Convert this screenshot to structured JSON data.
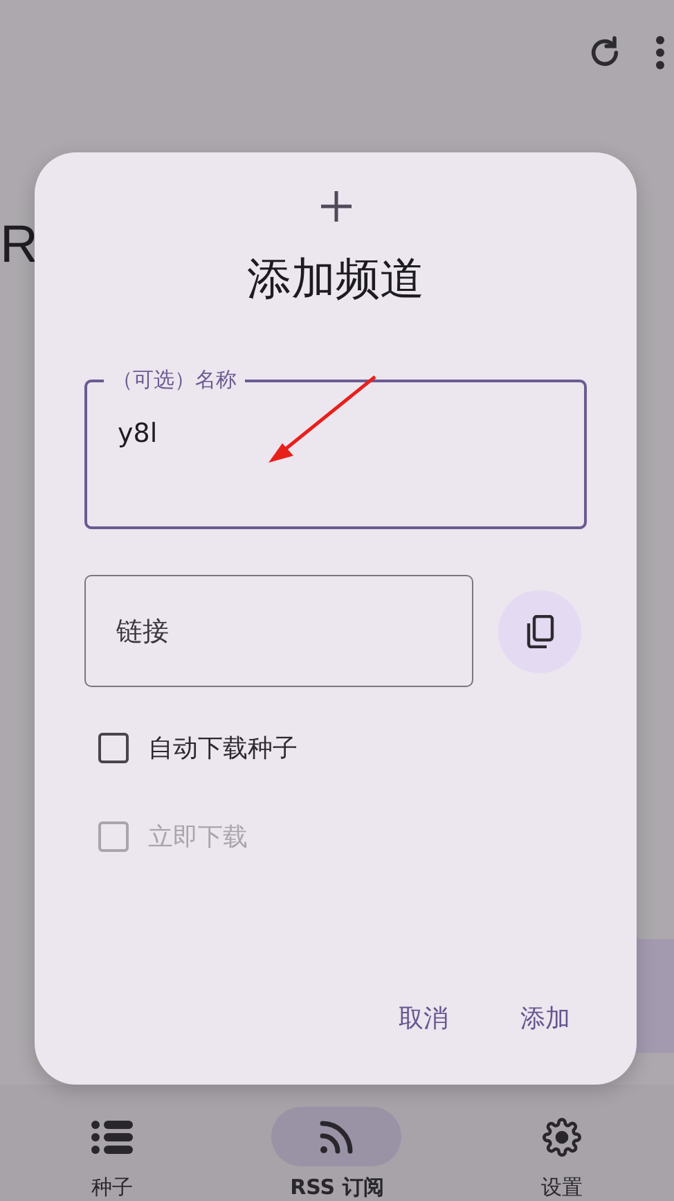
{
  "page": {
    "title": "R"
  },
  "dialog": {
    "title": "添加频道",
    "name_field": {
      "label": "（可选）名称",
      "value": "y8l",
      "focused": true
    },
    "link_field": {
      "placeholder": "链接"
    },
    "options": [
      {
        "label": "自动下载种子",
        "checked": false,
        "disabled": false
      },
      {
        "label": "立即下载",
        "checked": false,
        "disabled": true
      }
    ],
    "buttons": [
      {
        "label": "取消"
      },
      {
        "label": "添加"
      }
    ]
  },
  "bottom_nav": [
    {
      "label": "种子",
      "selected": false
    },
    {
      "label": "RSS 订阅",
      "selected": true
    },
    {
      "label": "设置",
      "selected": false
    }
  ]
}
